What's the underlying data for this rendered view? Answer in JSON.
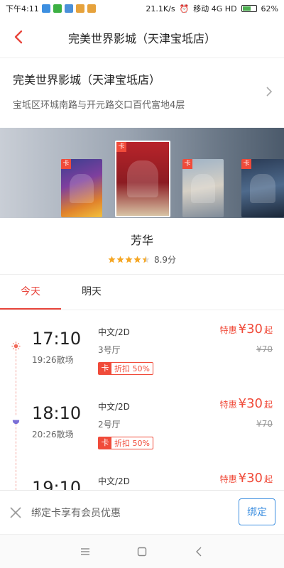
{
  "status_bar": {
    "time": "下午4:11",
    "net_speed": "21.1K/s",
    "carrier": "移动 4G HD",
    "battery": "62%",
    "battery_level": 0.62
  },
  "nav": {
    "title": "完美世界影城（天津宝坻店）",
    "back_icon": "chevron-left-icon"
  },
  "cinema": {
    "name": "完美世界影城（天津宝坻店）",
    "address": "宝坻区环城南路与开元路交口百代富地4层"
  },
  "posters": {
    "card_tag": "卡"
  },
  "movie": {
    "title": "芳华",
    "rating": "8.9分",
    "stars": 4.5
  },
  "tabs": [
    {
      "label": "今天",
      "active": true
    },
    {
      "label": "明天",
      "active": false
    }
  ],
  "sessions": [
    {
      "start": "17:10",
      "end": "19:26散场",
      "lang": "中文/2D",
      "hall": "3号厅",
      "promo_tag": "卡",
      "promo_text": "折扣 50%",
      "price_prefix": "特惠",
      "price": "¥30",
      "price_suffix": "起",
      "orig_price": "¥70",
      "icon": "sun-icon"
    },
    {
      "start": "18:10",
      "end": "20:26散场",
      "lang": "中文/2D",
      "hall": "2号厅",
      "promo_tag": "卡",
      "promo_text": "折扣 50%",
      "price_prefix": "特惠",
      "price": "¥30",
      "price_suffix": "起",
      "orig_price": "¥70",
      "icon": "moon-icon"
    },
    {
      "start": "19:10",
      "end": "",
      "lang": "中文/2D",
      "hall": "",
      "promo_tag": "",
      "promo_text": "",
      "price_prefix": "特惠",
      "price": "¥30",
      "price_suffix": "起",
      "orig_price": "",
      "icon": ""
    }
  ],
  "bind_bar": {
    "text": "绑定卡享有会员优惠",
    "button": "绑定"
  },
  "colors": {
    "accent": "#e8453c",
    "link_blue": "#3d8fe0"
  }
}
